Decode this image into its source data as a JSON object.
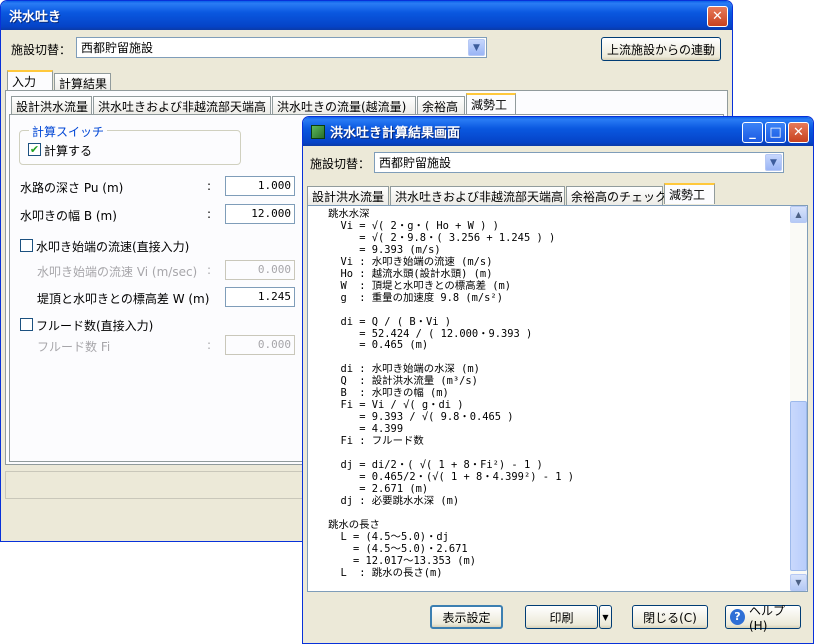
{
  "main_window": {
    "title": "洪水吐き",
    "close_icon": "close-icon",
    "facility_label": "施設切替：",
    "facility_value": "西都貯留施設",
    "upstream_button": "上流施設からの連動",
    "outer_tabs": [
      "入力",
      "計算結果"
    ],
    "inner_tabs": [
      "設計洪水流量",
      "洪水吐きおよび非越流部天端高",
      "洪水吐きの流量(越流量)",
      "余裕高",
      "減勢工"
    ],
    "calc_switch_label": "計算スイッチ",
    "calc_checkbox_label": "計算する",
    "fields": [
      {
        "label": "水路の深さ Pu (m)",
        "value": "1.000",
        "enabled": true
      },
      {
        "label": "水叩きの幅 B (m)",
        "value": "12.000",
        "enabled": true
      }
    ],
    "direct_velocity_label": "水叩き始端の流速(直接入力)",
    "velocity_label": "水叩き始端の流速 Vi (m/sec)",
    "velocity_value": "0.000",
    "height_diff_label": "堤頂と水叩きとの標高差 W (m)",
    "height_diff_value": "1.245",
    "froude_direct_label": "フルード数(直接入力)",
    "froude_label": "フルード数  Fi",
    "froude_value": "0.000",
    "colon": ":"
  },
  "result_window": {
    "title": "洪水吐き計算結果画面",
    "app_icon": "app-icon",
    "facility_label": "施設切替：",
    "facility_value": "西都貯留施設",
    "tabs": [
      "設計洪水流量",
      "洪水吐きおよび非越流部天端高",
      "余裕高のチェック",
      "減勢工"
    ],
    "result_text": "跳水水深\n  Vi = √( 2・g・( Ho + W ) )\n     = √( 2・9.8・( 3.256 + 1.245 ) )\n     = 9.393 (m/s)\n  Vi : 水叩き始端の流速 (m/s)\n  Ho : 越流水頭(設計水頭) (m)\n  W  : 頂堤と水叩きとの標高差 (m)\n  g  : 重量の加速度 9.8 (m/s²)\n\n  di = Q / ( B・Vi )\n     = 52.424 / ( 12.000・9.393 )\n     = 0.465 (m)\n\n  di : 水叩き始端の水深 (m)\n  Q  : 設計洪水流量 (m³/s)\n  B  : 水叩きの幅 (m)\n  Fi = Vi / √( g・di )\n     = 9.393 / √( 9.8・0.465 )\n     = 4.399\n  Fi : フルード数\n\n  dj = di/2・( √( 1 + 8・Fi²) - 1 )\n     = 0.465/2・(√( 1 + 8・4.399²) - 1 )\n     = 2.671 (m)\n  dj : 必要跳水水深 (m)\n\n跳水の長さ\n  L = (4.5～5.0)・dj\n    = (4.5～5.0)・2.671\n    = 12.017～13.353 (m)\n  L  : 跳水の長さ(m)",
    "buttons": {
      "display_settings": "表示設定",
      "print": "印刷",
      "close": "閉じる(C)",
      "help": "ヘルプ(H)"
    }
  }
}
